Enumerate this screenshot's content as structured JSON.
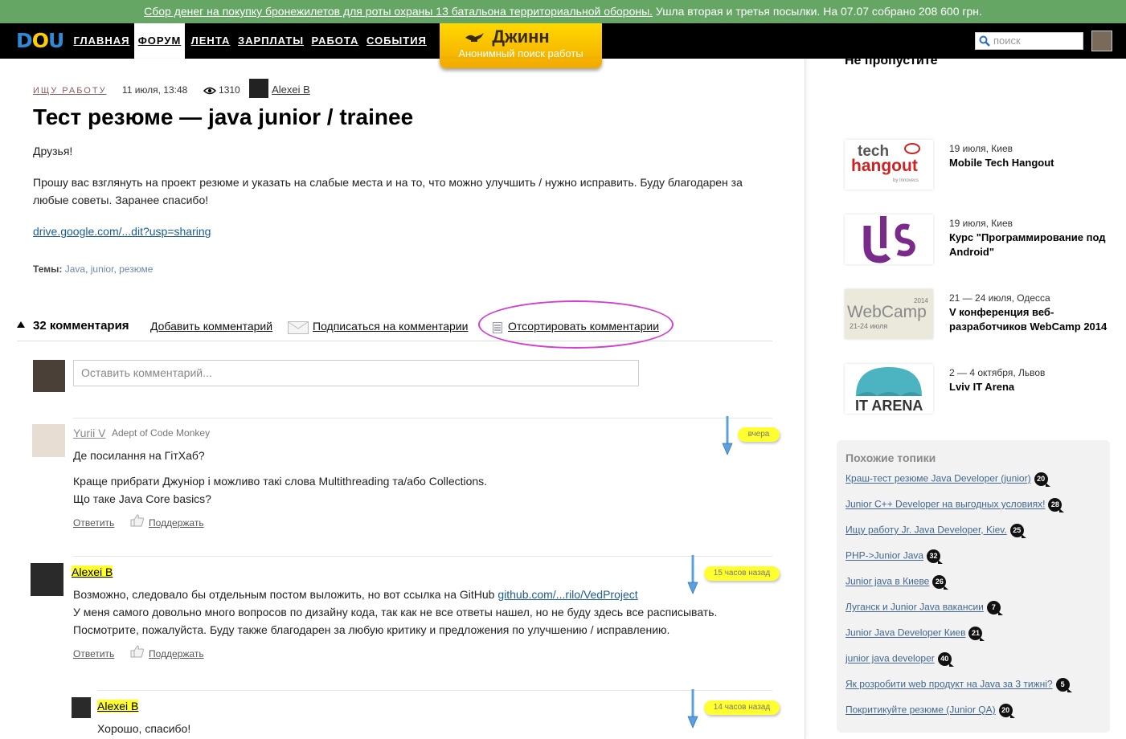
{
  "banner": {
    "link_text": "Сбор денег на покупку бронежилетов для роты охраны 13 батальона территориальной обороны.",
    "rest_text": " Ушла вторая и третья посылки. На 07.07 собрано 208 600 грн."
  },
  "nav": {
    "logo": {
      "d": "D",
      "o": "O",
      "u": "U"
    },
    "items": [
      "ГЛАВНАЯ",
      "ФОРУМ",
      "ЛЕНТА",
      "ЗАРПЛАТЫ",
      "РАБОТА",
      "СОБЫТИЯ"
    ],
    "active_index": 1,
    "djinn_title": "Джинн",
    "djinn_subtitle": "Анонимный поиск работы",
    "search_placeholder": "поиск"
  },
  "post": {
    "category": "ИЩУ РАБОТУ",
    "date": "11 июля, 13:48",
    "views": "1310",
    "author": "Alexei B",
    "title": "Тест резюме — java junior / trainee",
    "greeting": "Друзья!",
    "body": "Прошу вас взглянуть на проект резюме и указать на слабые места и на то, что можно улучшить / нужно исправить. Буду благодарен за любые советы. Заранее спасибо!",
    "link": "drive.google.com/...dit?usp=sharing",
    "tags_label": "Темы:",
    "tags": [
      "Java",
      "junior",
      "резюме"
    ]
  },
  "comments_bar": {
    "count": "32 комментария",
    "add": "Добавить комментарий",
    "subscribe": "Подписаться на комментарии",
    "sort": "Отсортировать комментарии",
    "placeholder": "Оставить комментарий..."
  },
  "comments": [
    {
      "author": "Yurii V",
      "role": "Adept of Code Monkey",
      "time": "вчера",
      "lines": [
        "Де посилання на ГітХаб?",
        "Краще прибрати Джуніор і можливо такі слова Multithreading та/або Collections.",
        "Що таке Java Core basics?"
      ],
      "reply": "Ответить",
      "support": "Поддержать"
    },
    {
      "author": "Alexei B",
      "time": "15 часов назад",
      "line1_pre": "Возможно, следовало бы отдельным постом выложить, но вот ссылка на GitHub ",
      "line1_link": "github.com/...rilo/VedProject",
      "line2": "У меня самого довольно много вопросов по дизайну кода, так как не все ответы нашел, но не буду здесь все расписывать.",
      "line3": "Посмотрите, пожалуйста. Буду также благодарен за любую критику и предложения по улучшению / исправлению.",
      "reply": "Ответить",
      "support": "Поддержать"
    },
    {
      "author": "Alexei B",
      "time": "14 часов назад",
      "line1": "Хорошо, спасибо!"
    }
  ],
  "sidebar": {
    "title": "Не пропустите",
    "events": [
      {
        "date": "19 июля, Киев",
        "name": "Mobile Tech Hangout",
        "logo": "tech hangout"
      },
      {
        "date": "19 июля, Киев",
        "name": "Курс \"Программирование под Android\"",
        "logo": "u/s"
      },
      {
        "date": "21 — 24 июля, Одесса",
        "name": "V конференция веб-разработчиков WebCamp 2014",
        "logo": "WebCamp"
      },
      {
        "date": "2 — 4 октября, Львов",
        "name": "Lviv IT Arena",
        "logo": "IT ARENA"
      }
    ],
    "event_logos": {
      "tech": "tech",
      "hangout": "hangout",
      "by": "by Innovecs",
      "webcamp_year": "2014",
      "webcamp": "WebCamp",
      "webcamp_dates": "21-24 июля",
      "itarena": "IT ARENA"
    },
    "similar_title": "Похожие топики",
    "similar": [
      {
        "title": "Краш-тест резюме Java Developer (junior)",
        "count": "20"
      },
      {
        "title": "Junior C++ Developer на выгодных условиях!",
        "count": "28"
      },
      {
        "title": "Ищу работу Jr. Java Developer, Kiev.",
        "count": "25"
      },
      {
        "title": "PHP->Junior Java",
        "count": "32"
      },
      {
        "title": "Junior java в Киеве",
        "count": "26"
      },
      {
        "title": "Луганск и Junior Java вакансии",
        "count": "7"
      },
      {
        "title": "Junior Java Developer Киев",
        "count": "21"
      },
      {
        "title": "junior java developer",
        "count": "40"
      },
      {
        "title": "Як розробити web продукт на Java за 3 тижні?",
        "count": "5"
      },
      {
        "title": "Покритикуйте резюме (Junior QA)",
        "count": "20"
      }
    ]
  }
}
